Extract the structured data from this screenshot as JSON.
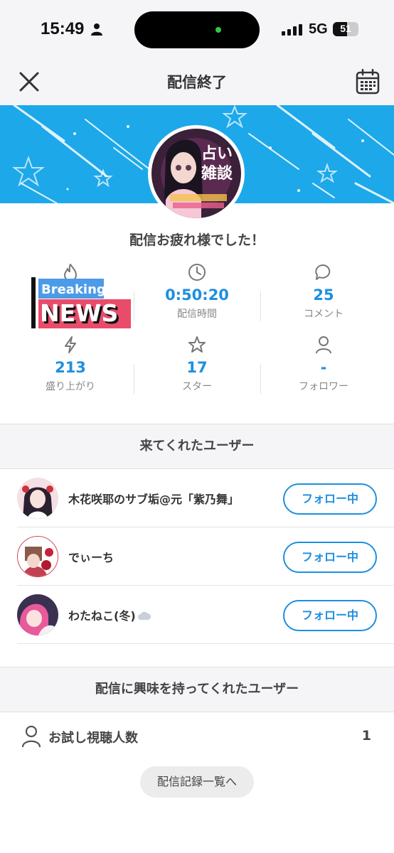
{
  "status_bar": {
    "time": "15:49",
    "network": "5G",
    "battery": "51"
  },
  "header": {
    "title": "配信終了"
  },
  "profile": {
    "thanks": "配信お疲れ様でした！"
  },
  "stats": [
    {
      "icon": "flame-icon",
      "value": "",
      "label": ""
    },
    {
      "icon": "clock-icon",
      "value": "0:50:20",
      "label": "配信時間"
    },
    {
      "icon": "comment-icon",
      "value": "25",
      "label": "コメント"
    },
    {
      "icon": "lightning-icon",
      "value": "213",
      "label": "盛り上がり"
    },
    {
      "icon": "star-icon",
      "value": "17",
      "label": "スター"
    },
    {
      "icon": "person-icon",
      "value": "-",
      "label": "フォロワー"
    }
  ],
  "news_sticker": {
    "line1": "Breaking",
    "line2": "NEWS"
  },
  "visited": {
    "title": "来てくれたユーザー",
    "users": [
      {
        "name": "木花咲耶のサブ垢@元「紫乃舞」",
        "button": "フォロー中"
      },
      {
        "name": "でぃーち",
        "button": "フォロー中"
      },
      {
        "name": "わたねこ(冬)",
        "button": "フォロー中"
      }
    ]
  },
  "interested": {
    "title": "配信に興味を持ってくれたユーザー",
    "trial_label": "お試し視聴人数",
    "trial_count": "1"
  },
  "history_button": "配信記録一覧へ",
  "colors": {
    "accent": "#1d8fe0",
    "banner": "#1da8ea"
  }
}
